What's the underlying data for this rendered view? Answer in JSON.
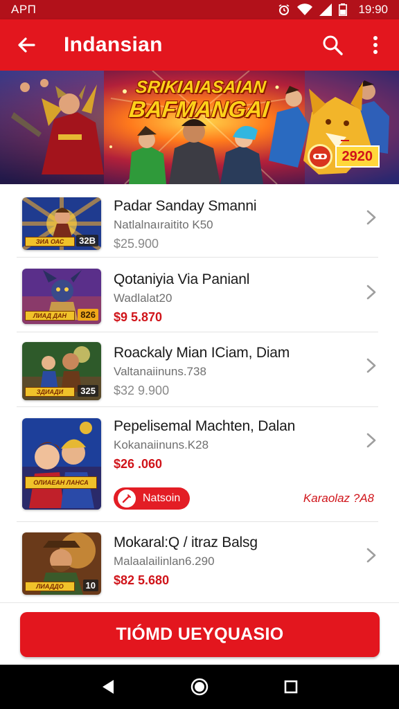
{
  "status_bar": {
    "carrier": "APΠ",
    "time": "19:90"
  },
  "app_bar": {
    "title": "Indansian"
  },
  "banner": {
    "title_line1": "SRIKIAIASAIAN",
    "title_line2": "BAFMANGAI",
    "badge_price": "2920"
  },
  "items": [
    {
      "title": "Padar Sanday Smanni",
      "subtitle": "Natlalnaıraitito K50",
      "price_currency": "$",
      "price_value": "$25.900",
      "thumb_tag": "32B"
    },
    {
      "title": "Qotaniyia Via Panianl",
      "subtitle": "Wadlalat20",
      "price_currency": "$",
      "price_value": "$9 5.870",
      "thumb_tag": "826"
    },
    {
      "title": "Roackaly Mian ICiam, Diam",
      "subtitle": "Valtanaiinuns.738",
      "price_currency": "$",
      "price_value": "$32 9.900",
      "thumb_tag": "325"
    },
    {
      "title": "Pepelisemal Machten, Dalan",
      "subtitle": "Kokanaiinuns.K28",
      "price_currency": "$",
      "price_value": "$26 .060",
      "pill_label": "Natsoin",
      "link_label": "Karaolaz ?A8"
    },
    {
      "title": "Mokaral:Q  / itraz Balsg",
      "subtitle": "Malaalailinlan6.290",
      "price_currency": "$",
      "price_value": "$82 5.680",
      "thumb_tag": "10"
    }
  ],
  "cta": {
    "label": "TIÓMD UEYQUASIO"
  },
  "colors": {
    "primary": "#e3161e",
    "primary_dark": "#b2111a",
    "price_red": "#d0141a"
  },
  "icons": [
    "back-arrow-icon",
    "search-icon",
    "more-vert-icon",
    "chevron-right-icon",
    "nav-back-icon",
    "nav-home-icon",
    "nav-recents-icon",
    "wifi-icon",
    "signal-icon",
    "battery-icon",
    "alarm-icon"
  ]
}
